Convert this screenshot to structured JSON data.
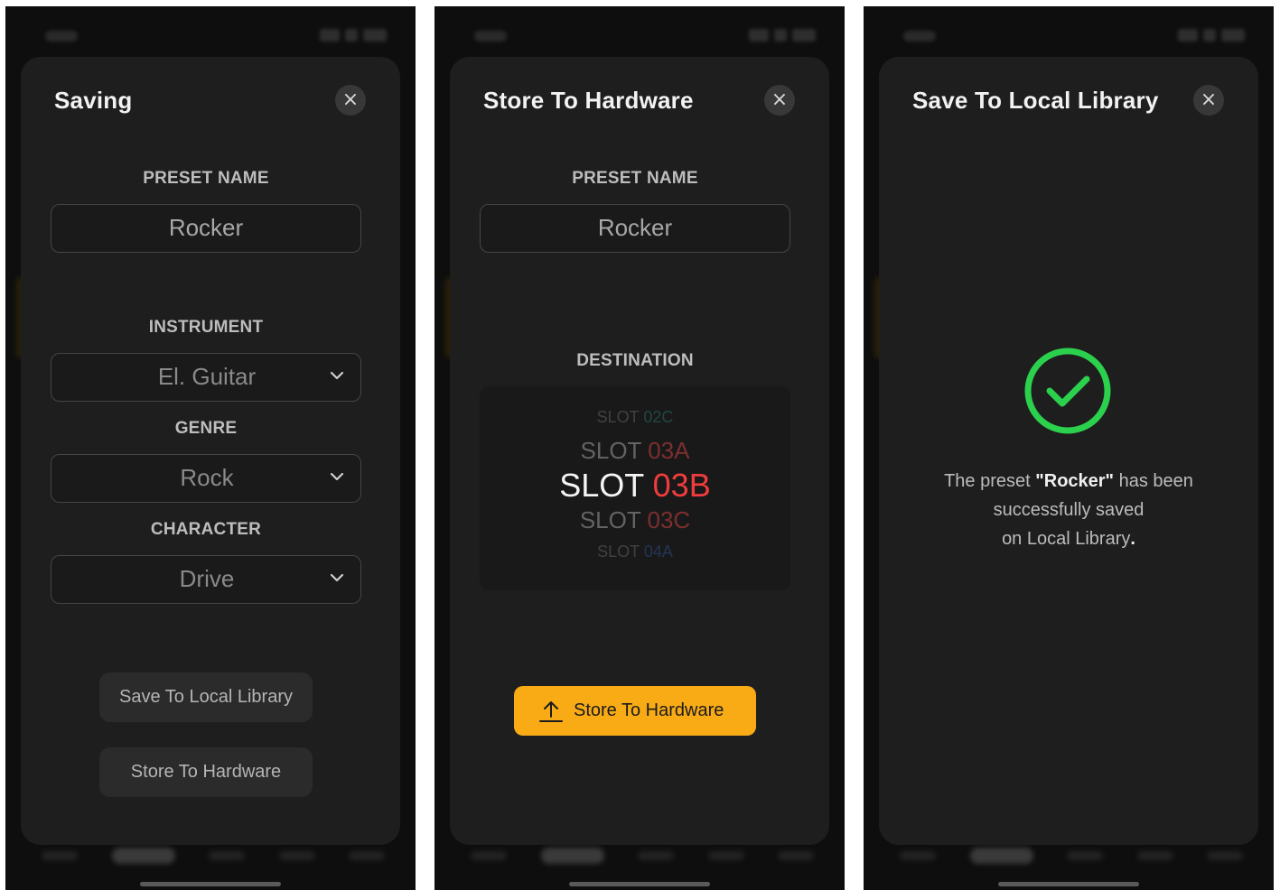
{
  "screen1": {
    "title": "Saving",
    "close_symbol": "×",
    "preset_name_label": "PRESET NAME",
    "preset_name_value": "Rocker",
    "instrument_label": "INSTRUMENT",
    "instrument_value": "El. Guitar",
    "genre_label": "GENRE",
    "genre_value": "Rock",
    "character_label": "CHARACTER",
    "character_value": "Drive",
    "save_local_button": "Save To Local Library",
    "store_hardware_button": "Store To Hardware"
  },
  "screen2": {
    "title": "Store To Hardware",
    "close_symbol": "×",
    "preset_name_label": "PRESET NAME",
    "preset_name_value": "Rocker",
    "destination_label": "DESTINATION",
    "slots": [
      {
        "prefix": "SLOT ",
        "code": "02C",
        "color": "#2f9a8a"
      },
      {
        "prefix": "SLOT ",
        "code": "03A",
        "color": "#b23b3b"
      },
      {
        "prefix": "SLOT ",
        "code": "03B",
        "color": "#f03c3c"
      },
      {
        "prefix": "SLOT ",
        "code": "03C",
        "color": "#b23b3b"
      },
      {
        "prefix": "SLOT ",
        "code": "04A",
        "color": "#3a66c8"
      }
    ],
    "store_button": "Store To Hardware",
    "accent_color": "#f9ab16"
  },
  "screen3": {
    "title": "Save To Local Library",
    "close_symbol": "×",
    "msg_part1": "The preset ",
    "msg_preset": "\"Rocker\"",
    "msg_part2": " has been",
    "msg_line2": "successfully saved",
    "msg_line3": "on Local Library",
    "msg_dot": ".",
    "success_color": "#2bd14d"
  },
  "icons": {
    "close": "close-icon",
    "dropdown": "chevron-down-icon",
    "upload": "upload-icon",
    "success": "check-circle-icon"
  }
}
